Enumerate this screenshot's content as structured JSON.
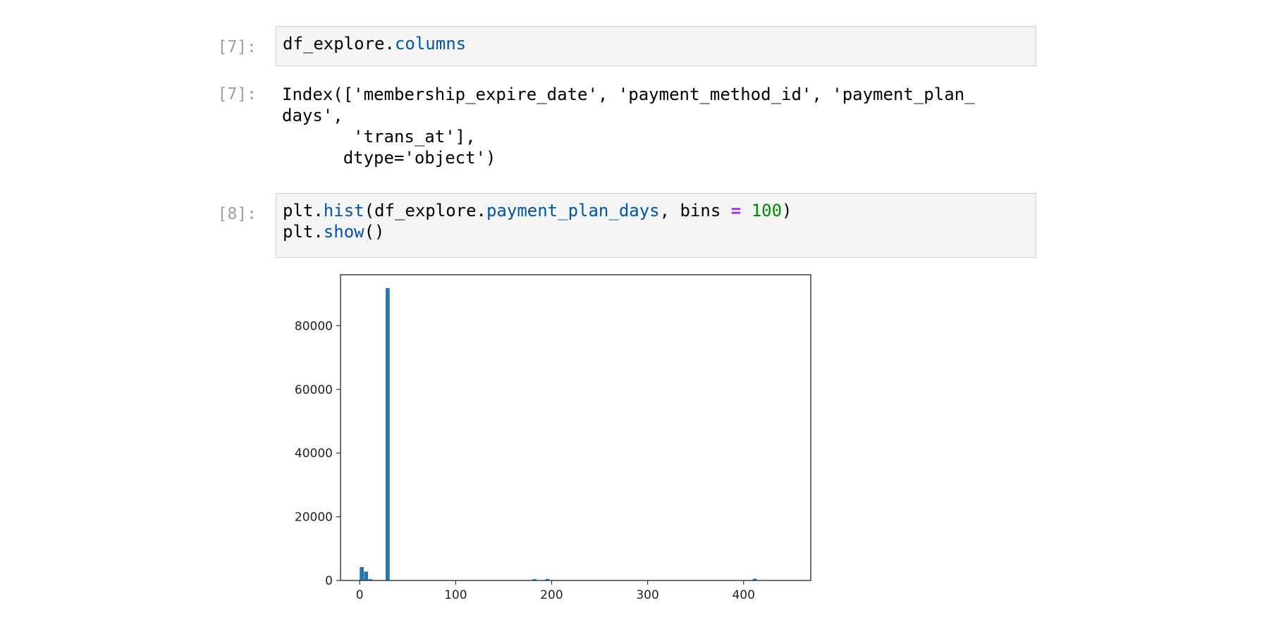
{
  "cells": [
    {
      "input_prompt": "[7]:",
      "code_lines": [
        [
          {
            "t": "df_explore."
          },
          {
            "t": "columns",
            "c": "attr"
          }
        ]
      ],
      "output_prompt": "[7]:",
      "output_text": "Index(['membership_expire_date', 'payment_method_id', 'payment_plan_\ndays',\n       'trans_at'],\n      dtype='object')"
    },
    {
      "input_prompt": "[8]:",
      "code_lines": [
        [
          {
            "t": "plt."
          },
          {
            "t": "hist",
            "c": "attr"
          },
          {
            "t": "(df_explore."
          },
          {
            "t": "payment_plan_days",
            "c": "attr"
          },
          {
            "t": ", bins "
          },
          {
            "t": "=",
            "c": "op"
          },
          {
            "t": " "
          },
          {
            "t": "100",
            "c": "num"
          },
          {
            "t": ")"
          }
        ],
        [
          {
            "t": "plt."
          },
          {
            "t": "show",
            "c": "attr"
          },
          {
            "t": "()"
          }
        ]
      ]
    }
  ],
  "chart_data": {
    "type": "bar",
    "kind": "histogram",
    "title": "",
    "xlabel": "",
    "ylabel": "",
    "xlim": [
      -20,
      470
    ],
    "ylim": [
      0,
      96000
    ],
    "xticks": [
      0,
      100,
      200,
      300,
      400
    ],
    "yticks": [
      0,
      20000,
      40000,
      60000,
      80000
    ],
    "color": "#1f77b4",
    "bin_width": 4.5,
    "bins": [
      {
        "x": 0,
        "value": 4200
      },
      {
        "x": 4.5,
        "value": 2800
      },
      {
        "x": 9,
        "value": 400
      },
      {
        "x": 27,
        "value": 91800
      },
      {
        "x": 180,
        "value": 400
      },
      {
        "x": 193.5,
        "value": 450
      },
      {
        "x": 409.5,
        "value": 550
      }
    ]
  }
}
